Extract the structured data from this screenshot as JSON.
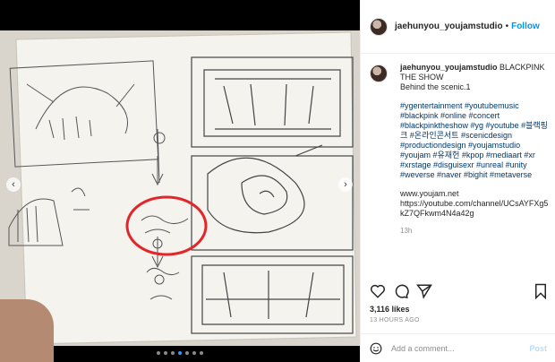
{
  "post": {
    "username": "jaehunyou_youjamstudio",
    "separator": "•",
    "follow_label": "Follow",
    "caption_title": "BLACKPINK THE SHOW",
    "caption_sub": "Behind the scenic.1",
    "hashtags": "#ygentertainment #youtubemusic #blackpink #online #concert #blackpinktheshow #yg #youtube #블랙핑크 #온라인콘서트 #scenicdesign #productiondesign #youjamstudio #youjam #유재헌 #kpop #mediaart #xr #xrstage #disguisexr #unreal #unity #weverse #naver #bighit #metaverse",
    "link1": "www.youjam.net",
    "link2": "https://youtube.com/channel/UCsAYFXg5kZ7QFkwm4N4a42g",
    "time_ago": "13h",
    "likes": "3,116 likes",
    "posted": "13 HOURS AGO",
    "comment_placeholder": "Add a comment...",
    "post_label": "Post"
  },
  "media": {
    "prev_icon": "‹",
    "next_icon": "›",
    "dot_count": 7,
    "active_dot": 3
  },
  "icons": {
    "heart": "heart-icon",
    "comment": "comment-icon",
    "share": "share-icon",
    "save": "bookmark-icon",
    "emoji": "emoji-icon"
  },
  "colors": {
    "link": "#00376b",
    "follow": "#0095f6",
    "red_circle": "#e3262a"
  }
}
